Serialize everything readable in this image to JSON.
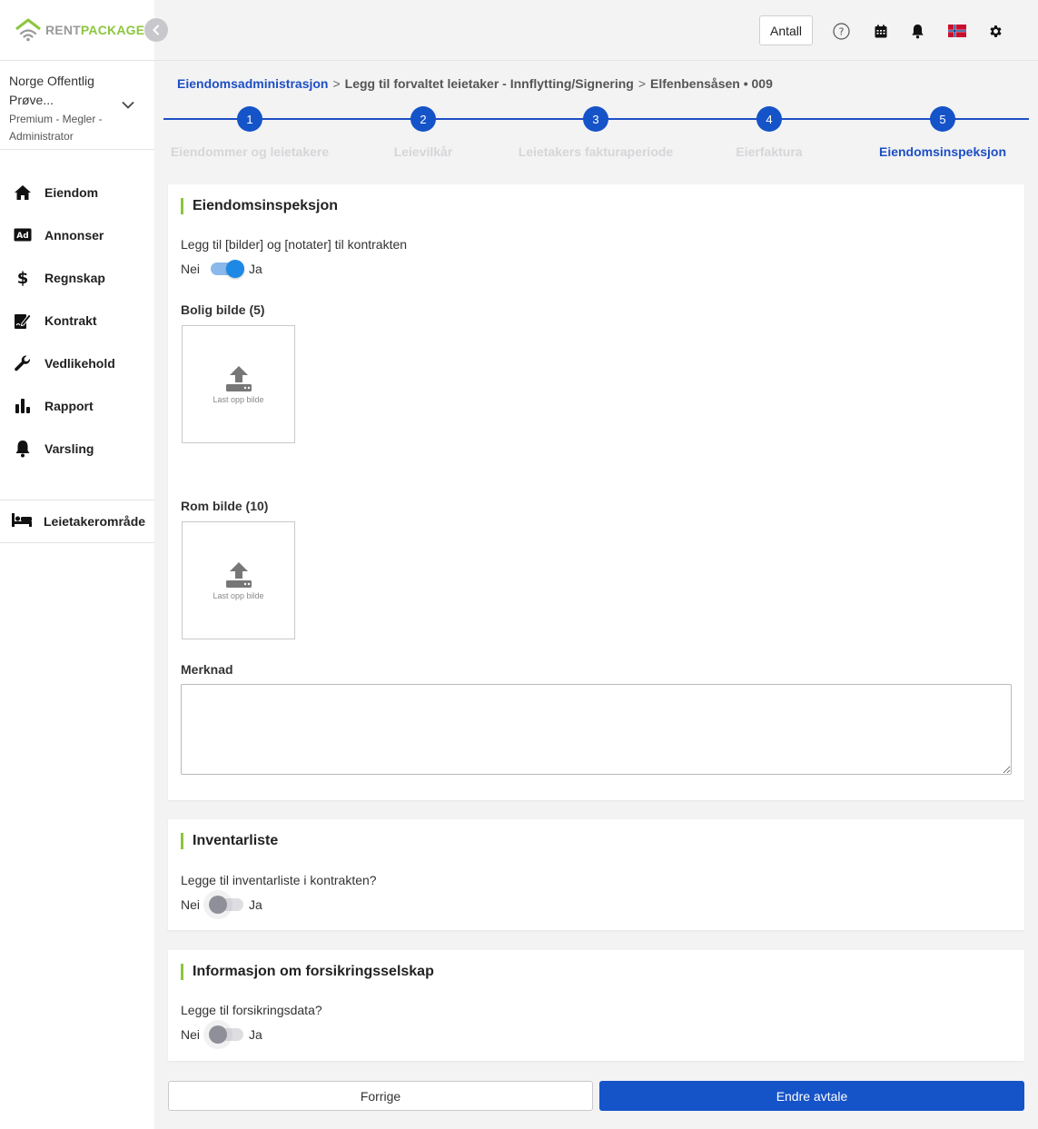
{
  "brand": {
    "name_part1": "RENT",
    "name_part2": "PACKAGE",
    "green": "#8cc63f",
    "gray": "#9a9a9a"
  },
  "sidebar": {
    "org_name_line1": "Norge Offentlig",
    "org_name_line2": "Prøve...",
    "org_role_line1": "Premium - Megler -",
    "org_role_line2": "Administrator",
    "items": [
      {
        "label": "Eiendom",
        "icon": "home-icon"
      },
      {
        "label": "Annonser",
        "icon": "ad-icon"
      },
      {
        "label": "Regnskap",
        "icon": "dollar-icon"
      },
      {
        "label": "Kontrakt",
        "icon": "contract-icon"
      },
      {
        "label": "Vedlikehold",
        "icon": "wrench-icon"
      },
      {
        "label": "Rapport",
        "icon": "bar-chart-icon"
      },
      {
        "label": "Varsling",
        "icon": "bell-icon"
      }
    ],
    "tenant_area": {
      "label": "Leietakerområde",
      "icon": "bed-icon"
    }
  },
  "topbar": {
    "antall_label": "Antall",
    "icons": [
      "help-icon",
      "calendar-icon",
      "bell-icon",
      "flag-icon",
      "gear-icon"
    ]
  },
  "breadcrumb": {
    "link": "Eiendomsadministrasjon",
    "separator": ">",
    "middle": "Legg til forvaltet leietaker - Innflytting/Signering",
    "current": "Elfenbensåsen • 009"
  },
  "stepper": {
    "accent": "#1553c8",
    "active_index": 5,
    "steps": [
      {
        "number": "1",
        "label": "Eiendommer og leietakere"
      },
      {
        "number": "2",
        "label": "Leievilkår"
      },
      {
        "number": "3",
        "label": "Leietakers fakturaperiode"
      },
      {
        "number": "4",
        "label": "Eierfaktura"
      },
      {
        "number": "5",
        "label": "Eiendomsinspeksjon"
      }
    ]
  },
  "inspection": {
    "title": "Eiendomsinspeksjon",
    "question": "Legg til [bilder] og [notater] til kontrakten",
    "toggle_no": "Nei",
    "toggle_yes": "Ja",
    "toggle_on": true,
    "housing_image_label": "Bolig bilde (5)",
    "room_image_label": "Rom bilde (10)",
    "upload_text": "Last opp bilde",
    "remark_label": "Merknad",
    "remark_value": ""
  },
  "inventory": {
    "title": "Inventarliste",
    "question": "Legge til inventarliste i kontrakten?",
    "toggle_no": "Nei",
    "toggle_yes": "Ja",
    "toggle_on": false
  },
  "insurance": {
    "title": "Informasjon om forsikringsselskap",
    "question": "Legge til forsikringsdata?",
    "toggle_no": "Nei",
    "toggle_yes": "Ja",
    "toggle_on": false
  },
  "footer": {
    "prev_label": "Forrige",
    "next_label": "Endre avtale"
  }
}
